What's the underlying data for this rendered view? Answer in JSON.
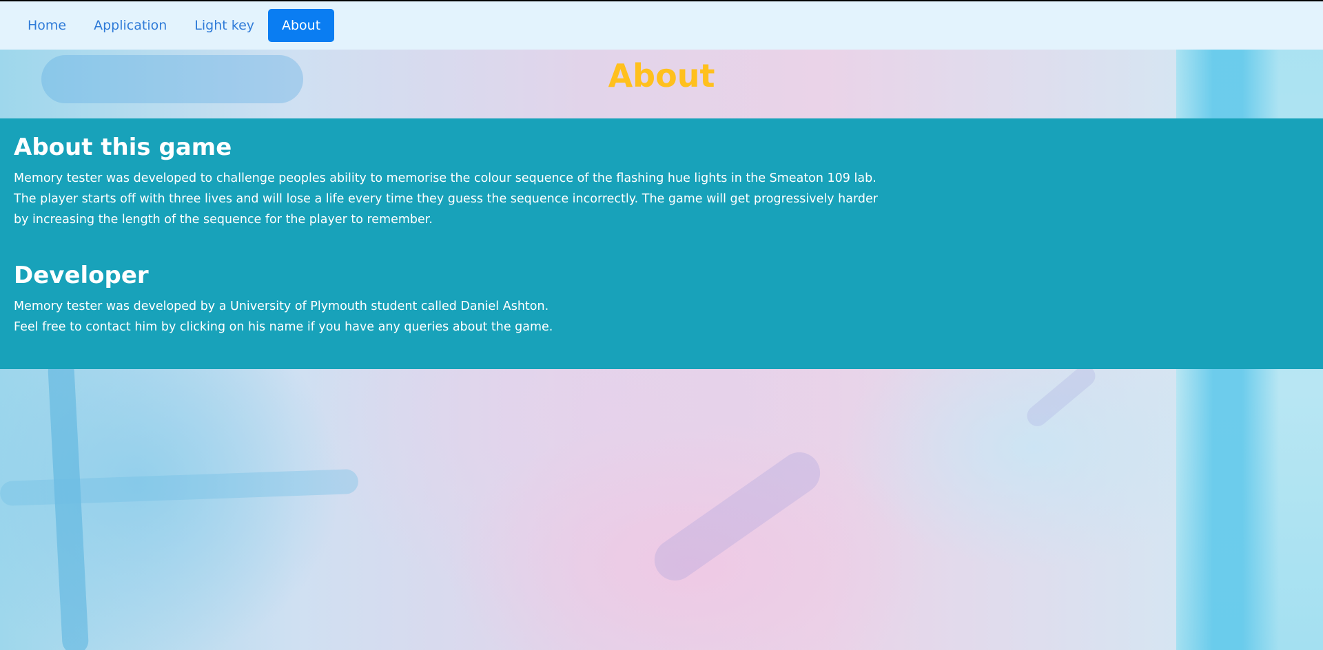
{
  "nav": {
    "items": [
      {
        "label": "Home",
        "active": false
      },
      {
        "label": "Application",
        "active": false
      },
      {
        "label": "Light key",
        "active": false
      },
      {
        "label": "About",
        "active": true
      }
    ]
  },
  "page": {
    "title": "About"
  },
  "about_section": {
    "heading": "About this game",
    "body": "Memory tester was developed to challenge peoples ability to memorise the colour sequence of the flashing hue lights in the Smeaton 109 lab. The player starts off with three lives and will lose a life every time they guess the sequence incorrectly. The game will get progressively harder by increasing the length of the sequence for the player to remember."
  },
  "developer_section": {
    "heading": "Developer",
    "line1_prefix": "Memory tester was developed by a University of Plymouth student called ",
    "developer_name": "Daniel Ashton",
    "line1_suffix": ".",
    "line2": "Feel free to contact him by clicking on his name if you have any queries about the game."
  },
  "colors": {
    "nav_bg": "#e3f3fd",
    "nav_link": "#2f7bd8",
    "nav_active_bg": "#0a7df2",
    "title": "#ffc01d",
    "content_bg": "#18a2ba"
  }
}
